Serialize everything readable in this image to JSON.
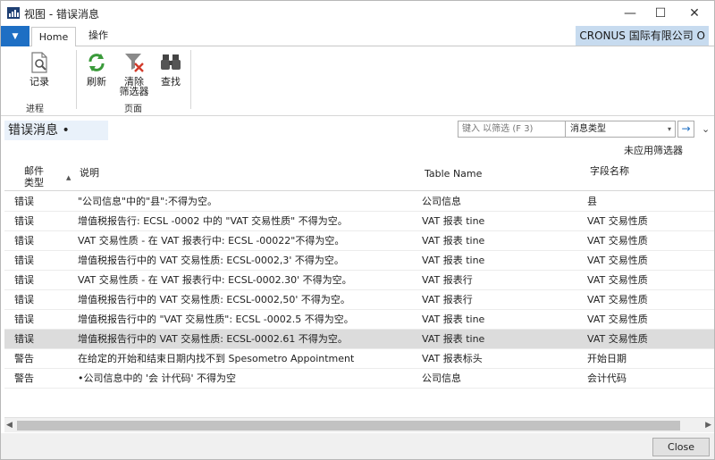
{
  "window": {
    "title": "视图 - 错误消息",
    "minimize_glyph": "—",
    "maximize_glyph": "☐",
    "close_glyph": "✕"
  },
  "ribbon": {
    "app_menu_glyph": "▼",
    "tabs": [
      {
        "label": "Home",
        "active": true
      },
      {
        "label": "操作",
        "active": false
      }
    ],
    "company": "CRONUS 国际有限公司 O",
    "buttons": {
      "record": {
        "label": "记录",
        "icon": "document-search-icon"
      },
      "refresh": {
        "label": "刷新",
        "icon": "refresh-icon"
      },
      "clear_filter": {
        "label": "清除\n筛选器",
        "icon": "clear-filter-icon"
      },
      "find": {
        "label": "查找",
        "icon": "binoculars-icon"
      }
    },
    "groups": {
      "process": "进程",
      "page": "页面"
    }
  },
  "page": {
    "title": "错误消息 •",
    "filter": {
      "placeholder": "键入 以筛选 (F 3)",
      "field": "消息类型",
      "dropdown_glyph": "▾",
      "go_glyph": "→"
    },
    "collapse_glyph": "⌄",
    "no_filter_text": "未应用筛选器"
  },
  "grid": {
    "columns": {
      "type": "邮件\n类型",
      "description": "说明",
      "table_name": "Table Name",
      "field_name": "字段名称"
    },
    "sort_glyph": "▲",
    "rows": [
      {
        "type": "错误",
        "description": "\"公司信息\"中的\"县\":不得为空。",
        "table": "公司信息",
        "field": "县",
        "selected": false
      },
      {
        "type": "错误",
        "description": "增值税报告行: ECSL -0002 中的 \"VAT 交易性质\" 不得为空。",
        "table": "VAT 报表 tine",
        "field": "VAT 交易性质",
        "selected": false
      },
      {
        "type": "错误",
        "description": "VAT 交易性质 - 在 VAT 报表行中: ECSL -00022\"不得为空。",
        "table": "VAT 报表 tine",
        "field": "VAT 交易性质",
        "selected": false
      },
      {
        "type": "错误",
        "description": "增值税报告行中的 VAT 交易性质: ECSL-0002,3' 不得为空。",
        "table": "VAT 报表 tine",
        "field": "VAT 交易性质",
        "selected": false
      },
      {
        "type": "错误",
        "description": "VAT 交易性质 - 在 VAT 报表行中: ECSL-0002.30' 不得为空。",
        "table": "VAT 报表行",
        "field": "VAT 交易性质",
        "selected": false
      },
      {
        "type": "错误",
        "description": "增值税报告行中的 VAT 交易性质: ECSL-0002,50' 不得为空。",
        "table": "VAT 报表行",
        "field": "VAT 交易性质",
        "selected": false
      },
      {
        "type": "错误",
        "description": "增值税报告行中的 \"VAT 交易性质\": ECSL -0002.5 不得为空。",
        "table": "VAT 报表 tine",
        "field": "VAT 交易性质",
        "selected": false
      },
      {
        "type": "错误",
        "description": "增值税报告行中的 VAT 交易性质: ECSL-0002.61 不得为空。",
        "table": "VAT 报表 tine",
        "field": "VAT 交易性质",
        "selected": true
      },
      {
        "type": "警告",
        "description": "在给定的开始和结束日期内找不到 Spesometro Appointment",
        "table": "VAT 报表标头",
        "field": "开始日期",
        "selected": false
      },
      {
        "type": "警告",
        "description": "•公司信息中的 '会 计代码' 不得为空",
        "table": "公司信息",
        "field": "会计代码",
        "selected": false
      }
    ]
  },
  "scrollbar": {
    "left_glyph": "◀",
    "right_glyph": "▶"
  },
  "footer": {
    "close_label": "Close"
  },
  "colors": {
    "accent": "#1e6fc4",
    "company_bg": "#c7dbef",
    "selected_row": "#dcdcdc"
  }
}
